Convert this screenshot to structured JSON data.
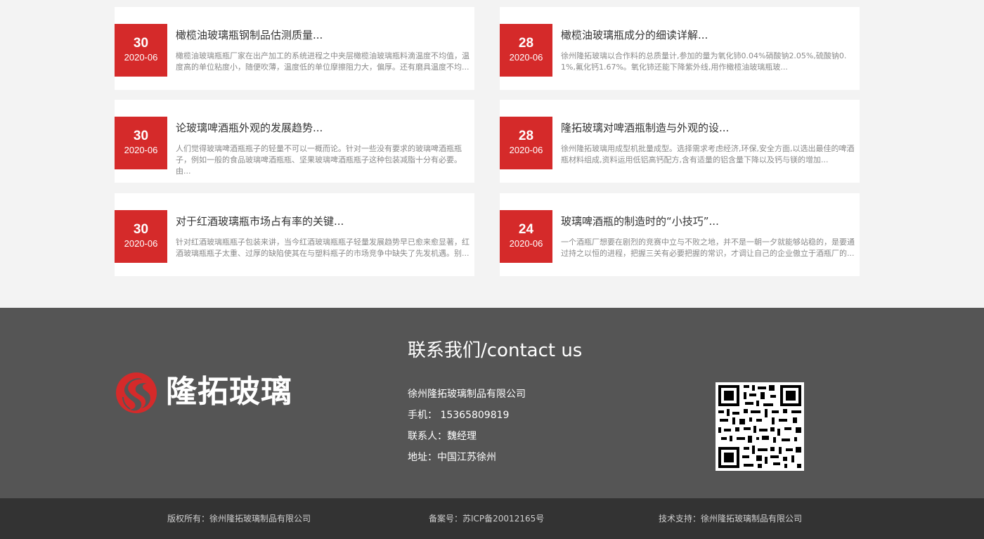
{
  "news": [
    {
      "day": "30",
      "ym": "2020-06",
      "title": "橄榄油玻璃瓶钢制品估测质量...",
      "desc": "橄榄油玻璃瓶瓶厂家在出产加工的系统进程之中夹层橄榄油玻璃瓶料滴温度不均值，温度高的单位粘度小，随便吹薄，温度低的单位摩擦阻力大，偏厚。还有磨具温度不均..."
    },
    {
      "day": "28",
      "ym": "2020-06",
      "title": "橄榄油玻璃瓶成分的细读详解...",
      "desc": "徐州隆拓玻璃以合作料的总质量计,参加的量为氧化铈0.04%硝酸钠2.05%,硫酸钠0.1%,氟化钙1.67%。氧化铈还能下降紫外线,用作橄榄油玻璃瓶玻..."
    },
    {
      "day": "30",
      "ym": "2020-06",
      "title": "论玻璃啤酒瓶外观的发展趋势...",
      "desc": "人们觉得玻璃啤酒瓶瓶子的轻量不可以一概而论。针对一些没有要求的玻璃啤酒瓶瓶子，例如一般的食品玻璃啤酒瓶瓶、坚果玻璃啤酒瓶瓶子这种包装减脂十分有必要。由..."
    },
    {
      "day": "28",
      "ym": "2020-06",
      "title": "隆拓玻璃对啤酒瓶制造与外观的设...",
      "desc": "徐州隆拓玻璃用成型机批量成型。选择需求考虑经济,环保,安全方面,以选出最佳的啤酒瓶材料组成,资料运用低铝高钙配方,含有适量的铝含量下降以及钙与镁的增加..."
    },
    {
      "day": "30",
      "ym": "2020-06",
      "title": "对于红酒玻璃瓶市场占有率的关键...",
      "desc": "针对红酒玻璃瓶瓶子包装来讲，当今红酒玻璃瓶瓶子轻量发展趋势早已愈来愈显著，红酒玻璃瓶瓶子太重、过厚的缺陷使其在与塑料瓶子的市场竞争中缺失了先发机遇。别..."
    },
    {
      "day": "24",
      "ym": "2020-06",
      "title": "玻璃啤酒瓶的制造时的“小技巧”...",
      "desc": "一个酒瓶厂想要在剧烈的竞赛中立与不败之地，并不是一朝一夕就能够站稳的，是要通过持之以恒的进程，把握三关有必要把握的常识，才调让自己的企业傲立于酒瓶厂的..."
    }
  ],
  "footer": {
    "logo_text": "隆拓玻璃",
    "contact_title": "联系我们/contact us",
    "company": "徐州隆拓玻璃制品有限公司",
    "phone": "手机：  15365809819",
    "contact_person": "联系人：魏经理",
    "address": "地址：中国江苏徐州"
  },
  "bottom": {
    "copyright": "版权所有：徐州隆拓玻璃制品有限公司",
    "icp": "备案号：苏ICP备20012165号",
    "support": "技术支持：徐州隆拓玻璃制品有限公司"
  },
  "colors": {
    "accent": "#d52a2a",
    "footer_bg": "#555555",
    "bottom_bg": "#333333"
  }
}
